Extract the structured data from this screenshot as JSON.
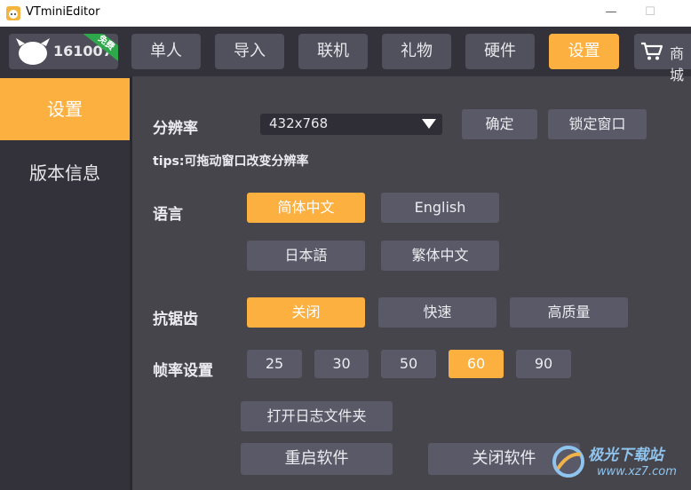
{
  "window": {
    "title": "VTminiEditor",
    "minimize": "—",
    "maximize": "☐"
  },
  "user": {
    "id": "161007...",
    "badge": "免费"
  },
  "nav": {
    "tabs": [
      "单人",
      "导入",
      "联机",
      "礼物",
      "硬件",
      "设置"
    ],
    "active": "设置",
    "shop": "商城"
  },
  "sidebar": {
    "items": [
      "设置",
      "版本信息"
    ],
    "active": "设置"
  },
  "settings": {
    "resolution": {
      "label": "分辨率",
      "value": "432x768",
      "confirm": "确定",
      "lock_window": "锁定窗口"
    },
    "tips": "tips:可拖动窗口改变分辨率",
    "language": {
      "label": "语言",
      "options": [
        "简体中文",
        "English",
        "日本語",
        "繁体中文"
      ],
      "selected": "简体中文"
    },
    "antialiasing": {
      "label": "抗锯齿",
      "options": [
        "关闭",
        "快速",
        "高质量"
      ],
      "selected": "关闭"
    },
    "framerate": {
      "label": "帧率设置",
      "options": [
        "25",
        "30",
        "50",
        "60",
        "90"
      ],
      "selected": "60"
    },
    "open_log_folder": "打开日志文件夹",
    "restart": "重启软件",
    "close": "关闭软件"
  },
  "watermark": {
    "text": "极光下载站",
    "url": "www.xz7.com"
  },
  "colors": {
    "accent": "#fcb03f",
    "panel": "#46454c",
    "button": "#5a5968",
    "dark": "#33323a"
  }
}
